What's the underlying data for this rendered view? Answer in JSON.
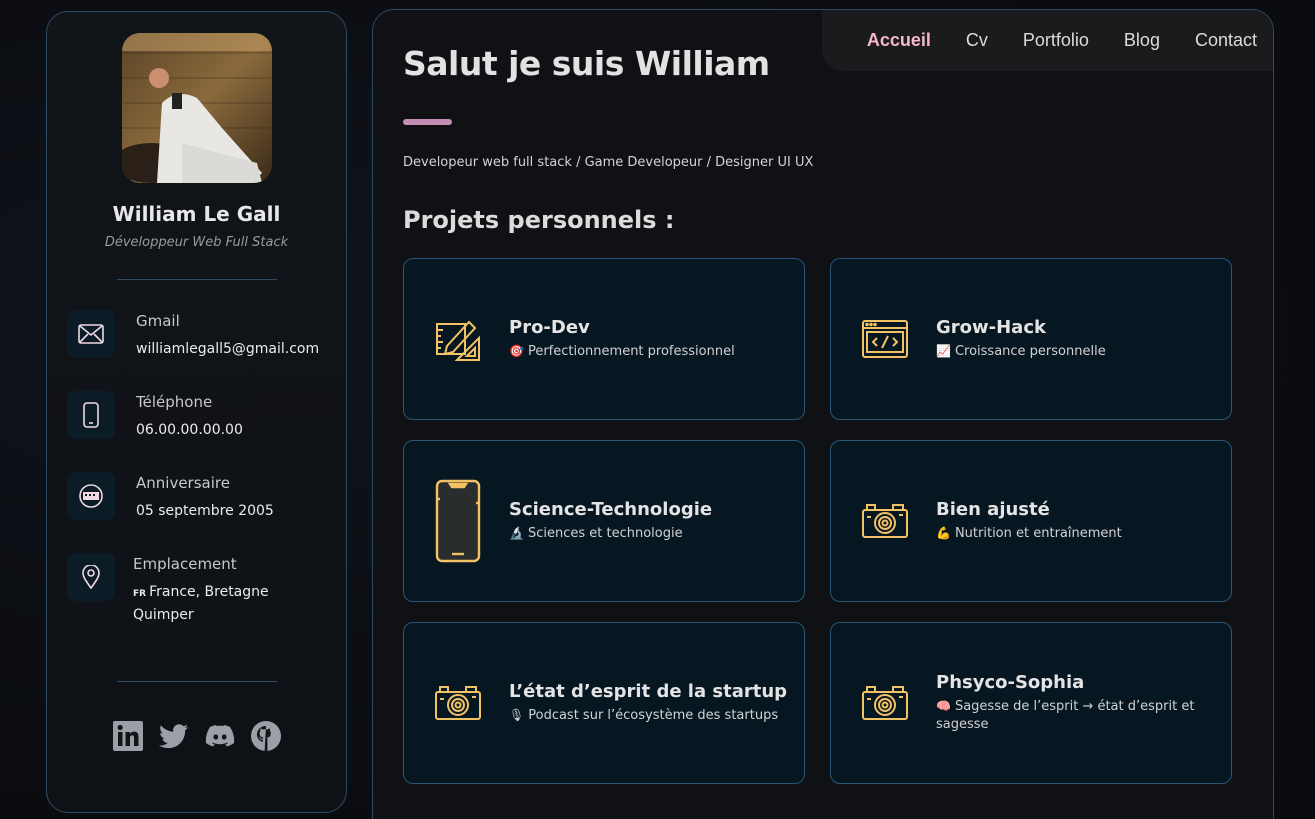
{
  "profile": {
    "name": "William Le Gall",
    "role": "Développeur Web Full Stack"
  },
  "contacts": [
    {
      "label": "Gmail",
      "value": "williamlegall5@gmail.com",
      "icon": "mail-icon"
    },
    {
      "label": "Téléphone",
      "value": "06.00.00.00.00",
      "icon": "phone-icon"
    },
    {
      "label": "Anniversaire",
      "value": "05 septembre 2005",
      "icon": "calendar-icon"
    },
    {
      "label": "Emplacement",
      "flag": "FR",
      "value": "France, Bretagne",
      "value2": "Quimper",
      "icon": "location-icon"
    }
  ],
  "socials": [
    "linkedin-icon",
    "twitter-icon",
    "discord-icon",
    "github-icon"
  ],
  "nav": {
    "items": [
      "Accueil",
      "Cv",
      "Portfolio",
      "Blog",
      "Contact"
    ],
    "active": "Accueil"
  },
  "main": {
    "title": "Salut je suis William",
    "subtitle": "Developeur web full stack / Game Developeur / Designer UI UX",
    "projects_heading": "Projets personnels :"
  },
  "projects": [
    {
      "title": "Pro-Dev",
      "emoji": "🎯",
      "desc": "Perfectionnement professionnel",
      "icon": "design-tools-icon"
    },
    {
      "title": "Grow-Hack",
      "emoji": "📈",
      "desc": "Croissance personnelle",
      "icon": "code-window-icon"
    },
    {
      "title": "Science-Technologie",
      "emoji": "🔬",
      "desc": "Sciences et technologie",
      "icon": "smartphone-icon"
    },
    {
      "title": "Bien ajusté",
      "emoji": "💪",
      "desc": "Nutrition et entraînement",
      "icon": "camera-icon"
    },
    {
      "title": "L’état d’esprit de la startup",
      "emoji": "🎙",
      "desc": "Podcast sur l’écosystème des startups",
      "icon": "camera-icon"
    },
    {
      "title": "Phsyco-Sophia",
      "emoji": "🧠",
      "desc": "Sagesse de l’esprit → état d’esprit et sagesse",
      "icon": "camera-icon"
    }
  ],
  "colors": {
    "accent_pink": "#c48db5",
    "nav_active": "#f6b7cc",
    "icon_gold": "#f2c265",
    "card_border": "#2c5578"
  }
}
